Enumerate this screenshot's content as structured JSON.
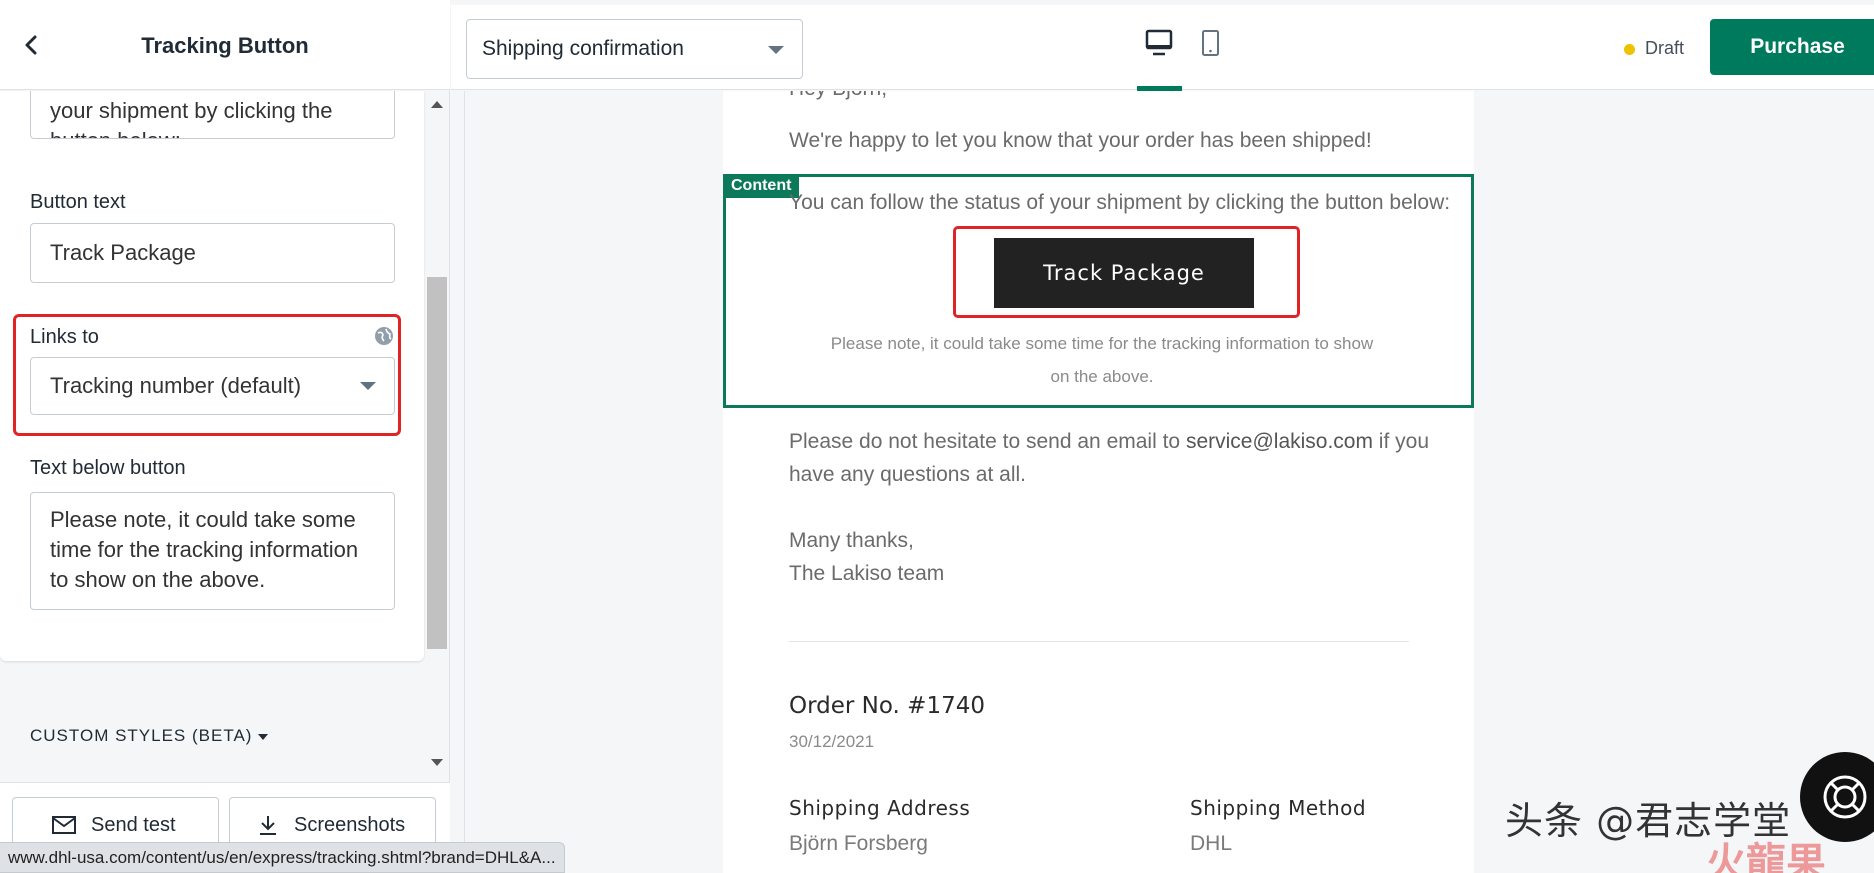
{
  "sidebar": {
    "title": "Tracking Button",
    "previous_text_value": "your shipment by clicking the button below:",
    "button_text_label": "Button text",
    "button_text_value": "Track Package",
    "links_to_label": "Links to",
    "links_to_value": "Tracking number (default)",
    "text_below_label": "Text below button",
    "text_below_value": "Please note, it could take some time for the tracking information to show on the above.",
    "custom_styles_label": "CUSTOM STYLES (BETA)",
    "footer": {
      "send_test_label": "Send test",
      "screenshots_label": "Screenshots"
    }
  },
  "topbar": {
    "template_value": "Shipping confirmation",
    "status_label": "Draft",
    "purchase_label": "Purchase"
  },
  "email": {
    "greeting": "Hey Björn,",
    "happy_text": "We're happy to let you know that your order has been shipped!",
    "content_badge": "Content",
    "follow_text": "You can follow the status of your shipment by clicking the button below:",
    "track_button_label": "Track Package",
    "note_text": "Please note, it could take some time for the tracking information to show on the above.",
    "contact_before": "Please do not hesitate to send an email to ",
    "contact_email": "service@lakiso.com",
    "contact_after": " if you have any questions at all.",
    "thanks_line1": "Many thanks,",
    "thanks_line2": "The Lakiso team",
    "order_number": "Order No. #1740",
    "order_date": "30/12/2021",
    "shipping_address_label": "Shipping Address",
    "shipping_address_value": "Björn Forsberg",
    "shipping_method_label": "Shipping Method",
    "shipping_method_value": "DHL"
  },
  "status_bar_url": "www.dhl-usa.com/content/us/en/express/tracking.shtml?brand=DHL&A...",
  "watermark_text": "头条 @君志学堂",
  "watermark_sub": "火龍果",
  "colors": {
    "accent": "#007a5c",
    "highlight": "#e02424",
    "draft": "#eec200",
    "button_dark": "#222222"
  },
  "icons": {
    "back": "chevron-left-icon",
    "globe": "globe-icon",
    "desktop": "desktop-icon",
    "mobile": "mobile-icon",
    "mail": "mail-icon",
    "download": "download-icon",
    "chat": "chat-icon"
  }
}
